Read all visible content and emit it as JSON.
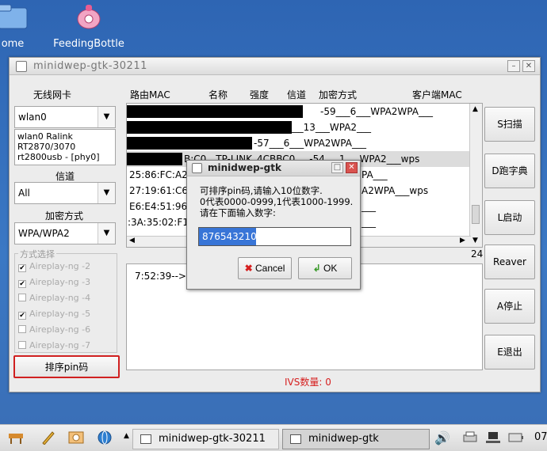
{
  "desktop": {
    "icons": [
      {
        "label": "ome"
      },
      {
        "label": "FeedingBottle"
      }
    ]
  },
  "main_window": {
    "title": "minidwep-gtk-30211",
    "left": {
      "wireless_card_label": "无线网卡",
      "wireless_card_value": "wlan0",
      "card_info_lines": [
        "wlan0 Ralink",
        "RT2870/3070",
        "rt2800usb - [phy0]"
      ],
      "channel_label": "信道",
      "channel_value": "All",
      "encryption_label": "加密方式",
      "encryption_value": "WPA/WPA2",
      "mode_group_title": "方式选择",
      "modes": [
        {
          "label": "Aireplay-ng -2",
          "checked": true
        },
        {
          "label": "Aireplay-ng -3",
          "checked": true
        },
        {
          "label": "Aireplay-ng -4",
          "checked": false
        },
        {
          "label": "Aireplay-ng -5",
          "checked": true
        },
        {
          "label": "Aireplay-ng -6",
          "checked": false
        },
        {
          "label": "Aireplay-ng -7",
          "checked": false
        }
      ],
      "sort_pin_button": "排序pin码"
    },
    "table": {
      "headers": [
        "路由MAC",
        "名称",
        "强度",
        "信道",
        "加密方式",
        "客户端MAC"
      ],
      "rows": [
        {
          "text": "-59___6___WPA2WPA___"
        },
        {
          "text": "-58___13___WPA2___"
        },
        {
          "text": "-57___6___WPA2WPA___"
        },
        {
          "text": "B:C0__TP-LINK_4CBBC0___-54___1___WPA2___wps"
        },
        {
          "text": "25:86:FC:A2"
        },
        {
          "text": "27:19:61:C6"
        },
        {
          "text": "E6:E4:51:96"
        },
        {
          "text": ":3A:35:02:F1"
        }
      ],
      "right_fragments": [
        "PA___",
        "A2WPA___wps",
        "___",
        "___"
      ],
      "count": "24"
    },
    "log_line": "7:52:39-->等",
    "ivs_label": "IVS数量: 0",
    "buttons": {
      "scan": "S扫描",
      "dict": "D跑字典",
      "start": "L启动",
      "reaver": "Reaver",
      "stop": "A停止",
      "exit": "E退出"
    }
  },
  "dialog": {
    "title": "minidwep-gtk",
    "message_lines": [
      "可排序pin码,请输入10位数字.",
      "0代表0000-0999,1代表1000-1999.",
      "请在下面输入数字:"
    ],
    "input_value": "8765432109",
    "cancel": "Cancel",
    "ok": "OK"
  },
  "taskbar": {
    "tasks": [
      {
        "label": "minidwep-gtk-30211"
      },
      {
        "label": "minidwep-gtk"
      }
    ],
    "clock": "07"
  },
  "colors": {
    "desktop": "#3a6ea5",
    "highlight": "#3875d7",
    "ivs": "#d62020",
    "pin_button_border": "#d02020"
  }
}
